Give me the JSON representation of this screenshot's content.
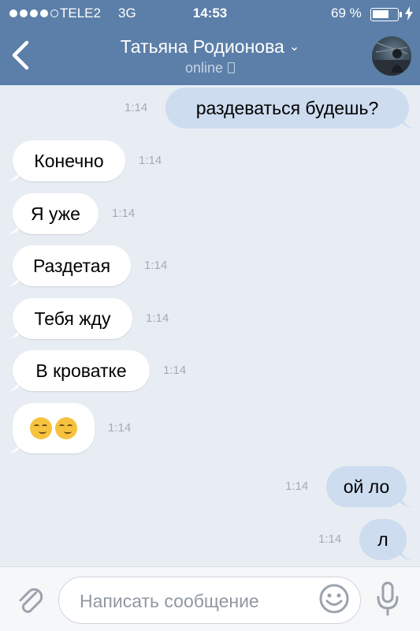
{
  "status_bar": {
    "carrier": "TELE2",
    "network": "3G",
    "time": "14:53",
    "battery_percent_text": "69 %",
    "battery_level": 0.69
  },
  "header": {
    "contact_name": "Татьяна Родионова",
    "contact_status": "online",
    "icons": [
      "back-chevron-icon",
      "chevron-down-icon",
      "phone-icon",
      "avatar"
    ]
  },
  "messages": [
    {
      "direction": "out",
      "text": "раздеваться будешь?",
      "time": "1:14"
    },
    {
      "direction": "in",
      "text": "Конечно",
      "time": "1:14"
    },
    {
      "direction": "in",
      "text": "Я уже",
      "time": "1:14"
    },
    {
      "direction": "in",
      "text": "Раздетая",
      "time": "1:14"
    },
    {
      "direction": "in",
      "text": "Тебя жду",
      "time": "1:14"
    },
    {
      "direction": "in",
      "text": "В кроватке",
      "time": "1:14"
    },
    {
      "direction": "in",
      "text": "😏😏",
      "time": "1:14"
    },
    {
      "direction": "out",
      "text": "ой ло",
      "time": "1:14"
    },
    {
      "direction": "out",
      "text": "л",
      "time": "1:14"
    }
  ],
  "composer": {
    "placeholder": "Написать сообщение",
    "icons": [
      "paperclip-icon",
      "smile-icon",
      "microphone-icon"
    ]
  },
  "colors": {
    "header": "#5b7fa8",
    "background": "#e8edf4",
    "incoming_bubble": "#ffffff",
    "outgoing_bubble": "#cddcef"
  }
}
